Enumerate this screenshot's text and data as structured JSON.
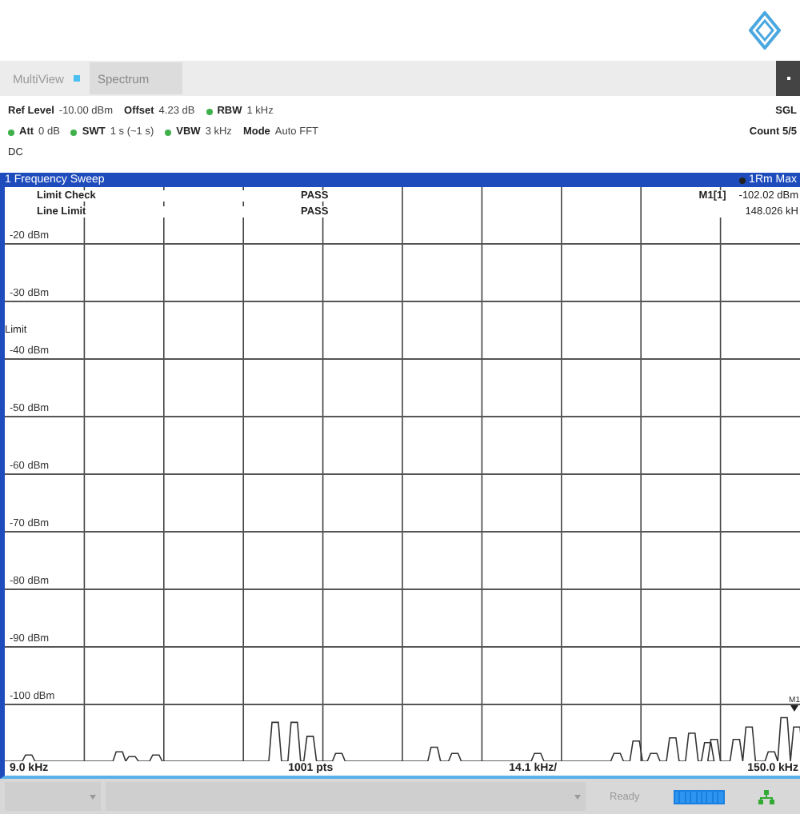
{
  "toolbar": {
    "view_label": "MultiView",
    "tabs": [
      {
        "label": "Spectrum",
        "selected": true
      }
    ]
  },
  "settings": {
    "rows": [
      [
        {
          "label": "Ref Level",
          "value": "-10.00 dBm",
          "dot": false
        },
        {
          "label": "Offset",
          "value": "4.23 dB",
          "dot": false
        },
        {
          "label": "RBW",
          "value": "1 kHz",
          "dot": true
        }
      ],
      [
        {
          "label": "Att",
          "value": "0 dB",
          "dot": true
        },
        {
          "label": "SWT",
          "value": "1 s (~1 s)",
          "dot": true
        },
        {
          "label": "VBW",
          "value": "3 kHz",
          "dot": true
        },
        {
          "label": "Mode",
          "value": "Auto FFT",
          "dot": false
        }
      ]
    ],
    "right": [
      "SGL",
      "Count 5/5"
    ],
    "coupling": "DC"
  },
  "window": {
    "title": "1 Frequency Sweep",
    "trace": "1Rm Max"
  },
  "plot": {
    "checks": [
      {
        "name": "Limit Check",
        "result": "PASS"
      },
      {
        "name": "Line Limit",
        "result": "PASS"
      }
    ],
    "marker": {
      "name": "M1[1]",
      "level": "-102.02 dBm",
      "frequency": "148.026 kH",
      "tag": "M1"
    },
    "level_labels": [
      "-20 dBm",
      "-30 dBm",
      "-40 dBm",
      "-50 dBm",
      "-60 dBm",
      "-70 dBm",
      "-80 dBm",
      "-90 dBm",
      "-100 dBm"
    ],
    "limit_label": "Limit"
  },
  "axis": {
    "start": "9.0 kHz",
    "points": "1001 pts",
    "span": "14.1 kHz/",
    "stop": "150.0 kHz"
  },
  "status": {
    "text": "Ready"
  }
}
